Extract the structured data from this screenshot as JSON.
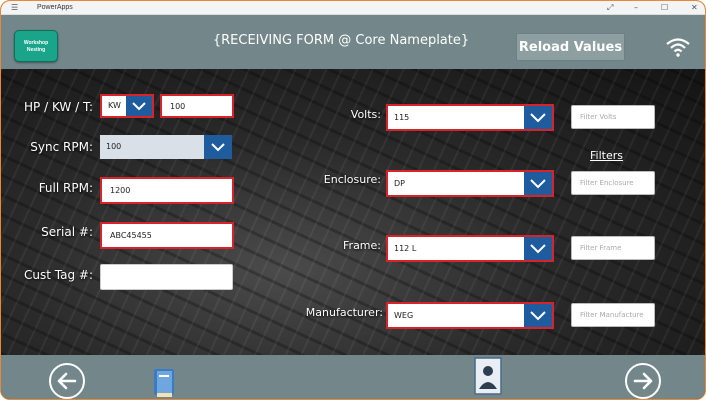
{
  "app": {
    "name": "PowerApps",
    "menu_glyph": "☰",
    "win_restore": "⤢",
    "win_min": "–",
    "win_max": "☐",
    "win_close": "✕"
  },
  "header": {
    "title": "{RECEIVING FORM @ Core Nameplate}",
    "reload_label": "Reload Values",
    "logo_line1": "Workshop",
    "logo_line2": "Nesting",
    "wifi_icon": "wifi-icon",
    "bg_color": "#73878a"
  },
  "left_form": {
    "hp_label": "HP / KW / T:",
    "hp_unit": "KW",
    "hp_value": "100",
    "sync_label": "Sync RPM:",
    "sync_value": "100",
    "full_label": "Full RPM:",
    "full_value": "1200",
    "serial_label": "Serial #:",
    "serial_value": "ABC45455",
    "cust_label": "Cust Tag #:",
    "cust_value": ""
  },
  "right_form": {
    "filters_heading": "Filters",
    "volts_label": "Volts:",
    "volts_value": "115",
    "volts_filter_placeholder": "Filter Volts",
    "enclosure_label": "Enclosure:",
    "enclosure_value": "DP",
    "enclosure_filter_placeholder": "Filter Enclosure",
    "frame_label": "Frame:",
    "frame_value": "112 L",
    "frame_filter_placeholder": "Filter Frame",
    "manufacturer_label": "Manufacturer:",
    "manufacturer_value": "WEG",
    "manufacturer_filter_placeholder": "Filter Manufacture"
  },
  "footer": {
    "back_icon": "arrow-left-icon",
    "next_icon": "arrow-right-icon",
    "book_icon": "book-icon",
    "person_icon": "person-document-icon"
  },
  "colors": {
    "accent": "#1f5c9e",
    "error_border": "#d8232a",
    "logo": "#1aa58a",
    "frame": "#e8883a"
  }
}
